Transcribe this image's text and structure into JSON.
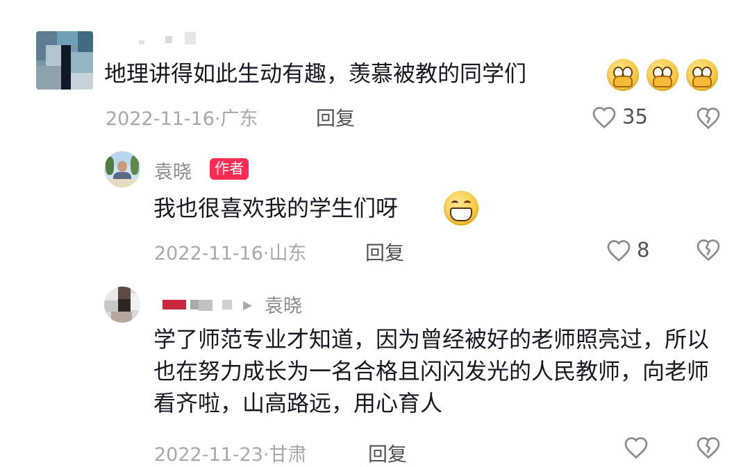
{
  "comments": [
    {
      "text": "地理讲得如此生动有趣，羡慕被教的同学们",
      "emojis": [
        "cover-mouth-emoji",
        "cover-mouth-emoji",
        "cover-mouth-emoji"
      ],
      "date": "2022-11-16",
      "location": "广东",
      "reply_label": "回复",
      "like_count": "35"
    },
    {
      "username": "袁晓",
      "badge": "作者",
      "text": "我也很喜欢我的学生们呀",
      "emojis": [
        "grin-emoji"
      ],
      "date": "2022-11-16",
      "location": "山东",
      "reply_label": "回复",
      "like_count": "8"
    },
    {
      "reply_to_arrow": "▶",
      "reply_to": "袁晓",
      "text": "学了师范专业才知道，因为曾经被好的老师照亮过，所以也在努力成长为一名合格且闪闪发光的人民教师，向老师看齐啦，山高路远，用心育人",
      "date": "2022-11-23",
      "location": "甘肃",
      "reply_label": "回复"
    }
  ],
  "meta_separator": "·",
  "colors": {
    "badge": "#fe2c55",
    "text": "#161823",
    "meta": "#a7a8ad"
  }
}
